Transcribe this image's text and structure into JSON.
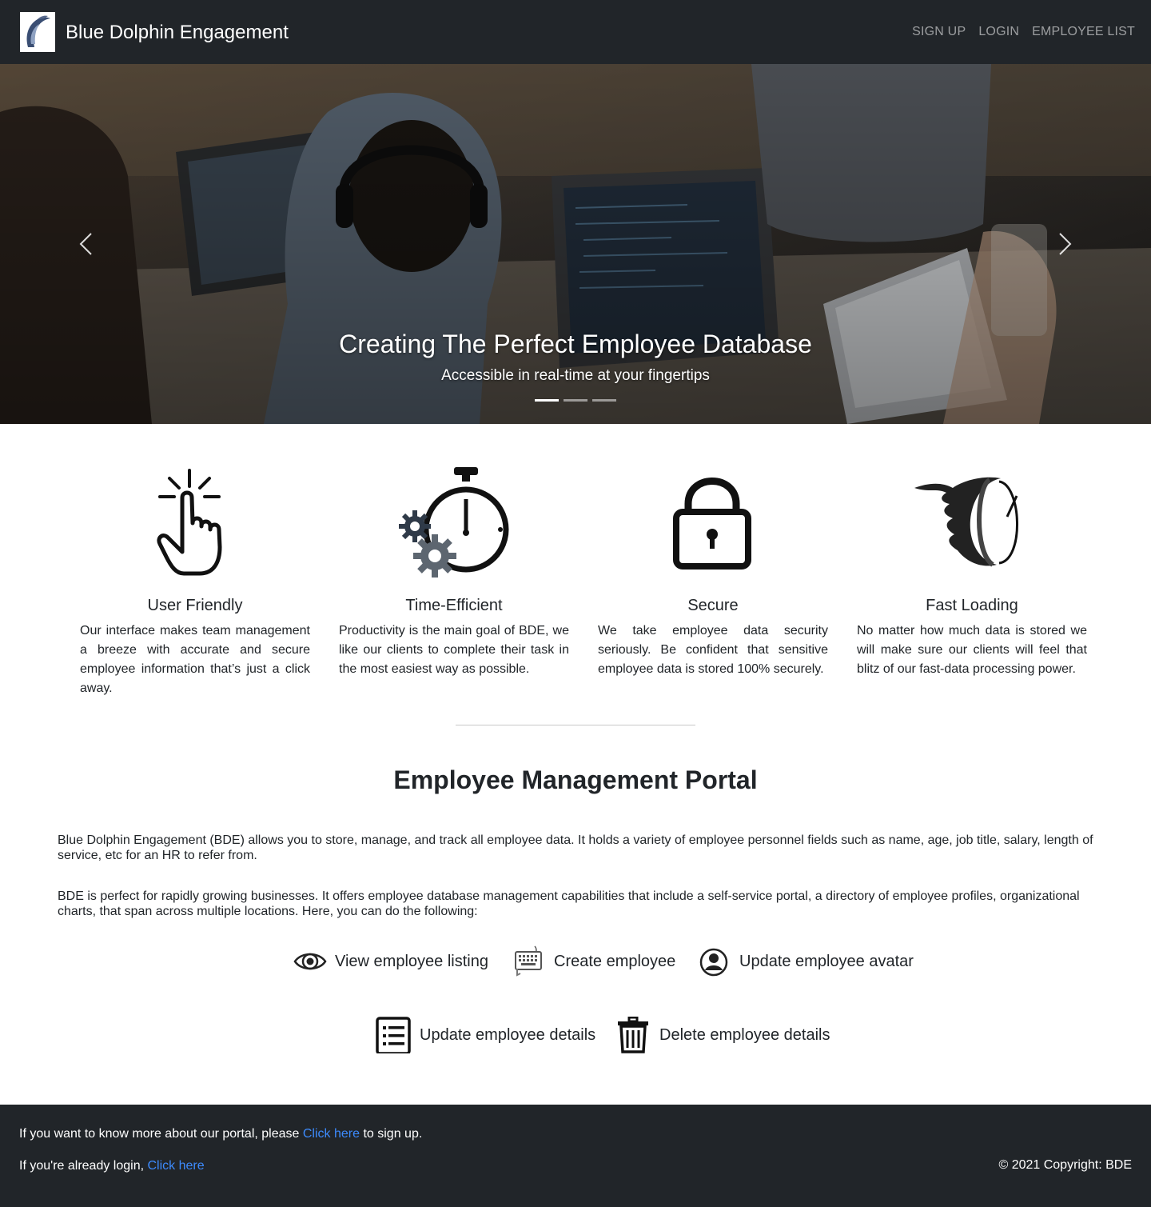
{
  "header": {
    "brand_name": "Blue Dolphin Engagement",
    "nav": [
      "SIGN UP",
      "LOGIN",
      "EMPLOYEE LIST"
    ]
  },
  "carousel": {
    "title": "Creating The Perfect Employee Database",
    "subtitle": "Accessible in real-time at your fingertips",
    "slide_count": 3,
    "active_slide": 1
  },
  "features": [
    {
      "title": "User Friendly",
      "text": "Our interface makes team management a breeze with accurate and secure employee information that’s just a click away.",
      "icon": "pointer-hand-icon"
    },
    {
      "title": "Time-Efficient",
      "text": "Productivity is the main goal of BDE, we like our clients to complete their task in the most easiest way as possible.",
      "icon": "stopwatch-gears-icon"
    },
    {
      "title": "Secure",
      "text": "We take employee data security seriously. Be confident that sensitive employee data is stored 100% securely.",
      "icon": "padlock-icon"
    },
    {
      "title": "Fast Loading",
      "text": "No matter how much data is stored we will make sure our clients will feel that blitz of our fast-data processing power.",
      "icon": "speed-clock-icon"
    }
  ],
  "portal": {
    "title": "Employee Management Portal",
    "paragraph1": "Blue Dolphin Engagement (BDE) allows you to store, manage, and track all employee data. It holds a variety of employee personnel fields such as name, age, job title, salary, length of service, etc for an HR to refer from.",
    "paragraph2": "BDE is perfect for rapidly growing businesses. It offers employee database management capabilities that include a self-service portal, a directory of employee profiles, organizational charts, that span across multiple locations. Here, you can do the following:",
    "actions": [
      {
        "label": "View employee listing",
        "icon": "eye-icon"
      },
      {
        "label": "Create employee",
        "icon": "keyboard-icon"
      },
      {
        "label": "Update employee avatar",
        "icon": "user-circle-icon"
      },
      {
        "label": "Update employee details",
        "icon": "document-list-icon"
      },
      {
        "label": "Delete employee details",
        "icon": "trash-icon"
      }
    ]
  },
  "footer": {
    "line1_before": "If you want to know more about our portal, please ",
    "line1_link": "Click here",
    "line1_after": " to sign up.",
    "line2_before": "If you're already login, ",
    "line2_link": "Click here",
    "copyright": "© 2021 Copyright: BDE"
  },
  "colors": {
    "navbar_bg": "#212529",
    "link": "#3d8bfd",
    "nav_link": "rgba(255,255,255,0.55)"
  }
}
